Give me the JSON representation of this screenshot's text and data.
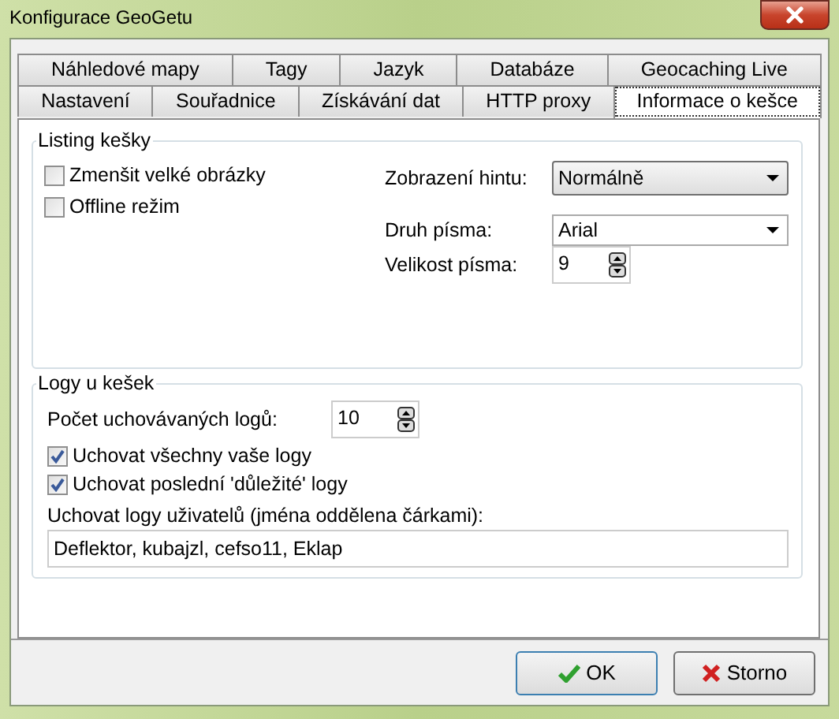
{
  "window": {
    "title": "Konfigurace GeoGetu"
  },
  "tab_rows": [
    [
      {
        "label": "Náhledové mapy",
        "selected": false
      },
      {
        "label": "Tagy",
        "selected": false
      },
      {
        "label": "Jazyk",
        "selected": false
      },
      {
        "label": "Databáze",
        "selected": false
      },
      {
        "label": "Geocaching Live",
        "selected": false
      }
    ],
    [
      {
        "label": "Nastavení",
        "selected": false
      },
      {
        "label": "Souřadnice",
        "selected": false
      },
      {
        "label": "Získávání dat",
        "selected": false
      },
      {
        "label": "HTTP proxy",
        "selected": false
      },
      {
        "label": "Informace o kešce",
        "selected": true
      }
    ]
  ],
  "listing": {
    "title": "Listing kešky",
    "checkboxes": [
      {
        "label": "Zmenšit velké obrázky",
        "checked": false
      },
      {
        "label": "Offline režim",
        "checked": false
      }
    ],
    "hint": {
      "label": "Zobrazení hintu:",
      "value": "Normálně"
    },
    "font": {
      "label": "Druh písma:",
      "value": "Arial"
    },
    "size": {
      "label": "Velikost písma:",
      "value": "9"
    }
  },
  "logs": {
    "title": "Logy u kešek",
    "count": {
      "label": "Počet uchovávaných logů:",
      "value": "10"
    },
    "checkboxes": [
      {
        "label": "Uchovat všechny vaše logy",
        "checked": true
      },
      {
        "label": "Uchovat poslední 'důležité' logy",
        "checked": true
      }
    ],
    "users": {
      "label": "Uchovat logy uživatelů (jména oddělena čárkami):",
      "value": "Deflektor, kubajzl, cefso11, Eklap"
    }
  },
  "buttons": [
    {
      "kind": "ok",
      "label": "OK"
    },
    {
      "kind": "cancel",
      "label": "Storno"
    }
  ]
}
